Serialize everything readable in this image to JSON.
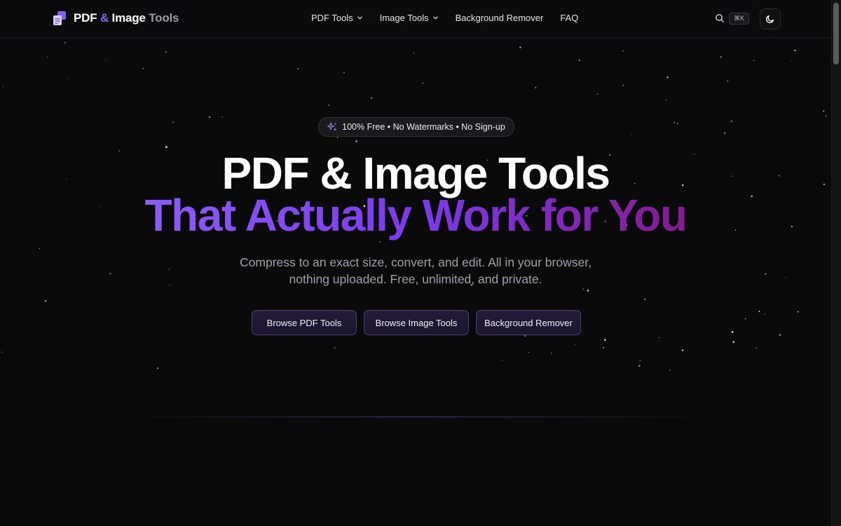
{
  "header": {
    "logo": {
      "part1": "PDF",
      "amp": "&",
      "part2": "Image",
      "part3": "Tools"
    },
    "nav": [
      {
        "label": "PDF Tools",
        "dropdown": true
      },
      {
        "label": "Image Tools",
        "dropdown": true
      },
      {
        "label": "Background Remover",
        "dropdown": false
      },
      {
        "label": "FAQ",
        "dropdown": false
      }
    ],
    "search_shortcut": "⌘K",
    "theme_icon": "moon-icon"
  },
  "hero": {
    "badge": "100% Free • No Watermarks • No Sign-up",
    "badge_icon": "sparkles-icon",
    "title_line1": "PDF & Image Tools",
    "title_line2": "That Actually Work for You",
    "subtitle_line1": "Compress to an exact size, convert, and edit. All in your browser,",
    "subtitle_line2": "nothing uploaded. Free, unlimited, and private.",
    "buttons": [
      {
        "label": "Browse PDF Tools"
      },
      {
        "label": "Browse Image Tools"
      },
      {
        "label": "Background Remover"
      }
    ]
  },
  "colors": {
    "background": "#0a0a0b",
    "accent": "#8b5cf6",
    "accent_end": "#86198f",
    "muted_text": "#a1a1aa"
  }
}
